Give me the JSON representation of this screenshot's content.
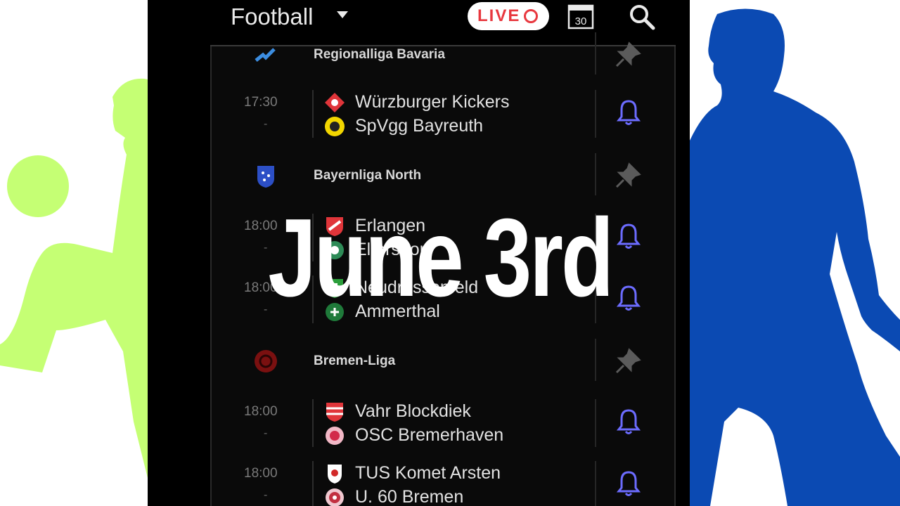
{
  "header": {
    "sport_label": "Football",
    "live_label": "LIVE",
    "calendar_day": "30"
  },
  "colors": {
    "accent_bell": "#6c6cff",
    "live_red": "#e8383f",
    "left_silhouette": "#c5ff74",
    "right_silhouette": "#0b4ab3"
  },
  "leagues": [
    {
      "name": "Regionalliga Bavaria",
      "logo_icon": "regionalliga-logo-icon",
      "matches": [
        {
          "time": "17:30",
          "dash": "-",
          "home": "Würzburger Kickers",
          "away": "SpVgg Bayreuth"
        }
      ]
    },
    {
      "name": "Bayernliga North",
      "logo_icon": "bayernliga-logo-icon",
      "matches": [
        {
          "time": "18:00",
          "dash": "-",
          "home": "Erlangen",
          "away": "Eltersdorf"
        },
        {
          "time": "18:00",
          "dash": "-",
          "home": "Neudrossenfeld",
          "away": "Ammerthal"
        }
      ]
    },
    {
      "name": "Bremen-Liga",
      "logo_icon": "bremen-liga-logo-icon",
      "matches": [
        {
          "time": "18:00",
          "dash": "-",
          "home": "Vahr Blockdiek",
          "away": "OSC Bremerhaven"
        },
        {
          "time": "18:00",
          "dash": "-",
          "home": "TUS Komet Arsten",
          "away": "U. 60 Bremen"
        }
      ]
    }
  ],
  "overlay": {
    "title": "June 3rd"
  }
}
